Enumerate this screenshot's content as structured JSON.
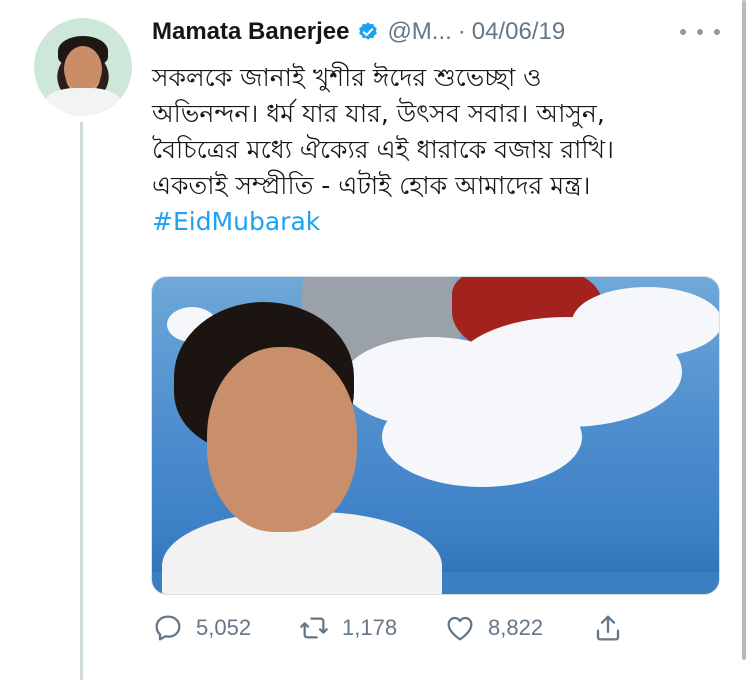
{
  "tweet": {
    "author_name": "Mamata Banerjee",
    "handle": "@M...",
    "separator": "·",
    "date": "04/06/19",
    "text_lines": [
      "সকলকে জানাই খুশীর ঈদের শুভেচ্ছা ও",
      "অভিনন্দন। ধর্ম যার যার, উৎসব  সবার। আসুন,",
      "বৈচিত্রের মধ্যে ঐক্যের এই ধারাকে বজায় রাখি।",
      "একতাই সম্প্রীতি - এটাই হোক আমাদের মন্ত্র।"
    ],
    "hashtag": "#EidMubarak"
  },
  "actions": {
    "replies": "5,052",
    "retweets": "1,178",
    "likes": "8,822"
  },
  "icons": {
    "verified": "verified-badge-icon",
    "more": "more-options-icon",
    "reply": "reply-icon",
    "retweet": "retweet-icon",
    "like": "heart-icon",
    "share": "share-icon"
  },
  "colors": {
    "link": "#1da1f2",
    "muted": "#657786",
    "verified": "#1da1f2"
  }
}
